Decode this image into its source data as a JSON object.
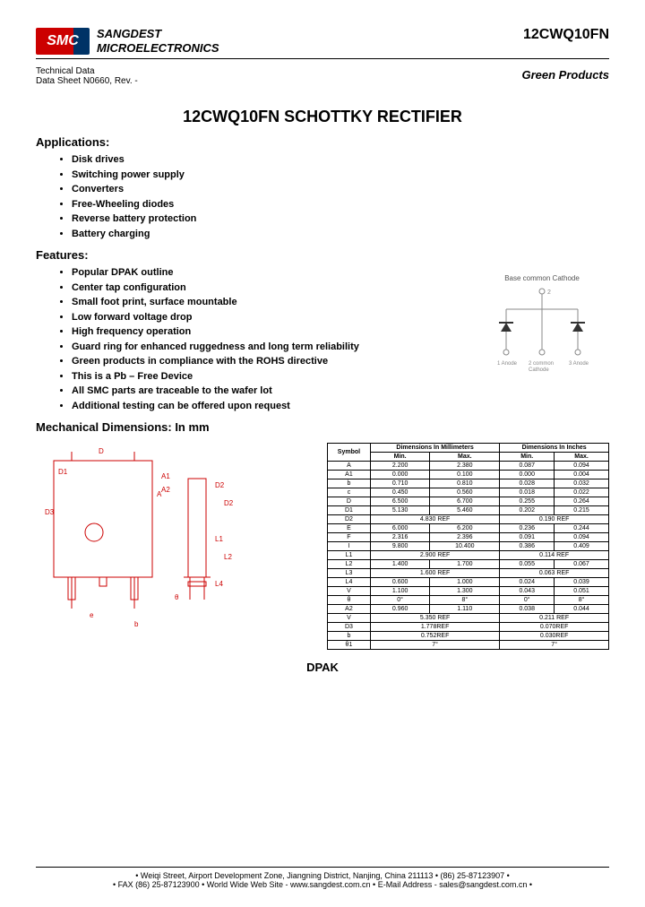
{
  "company_line1": "SANGDEST",
  "company_line2": "MICROELECTRONICS",
  "logo_text": "SMC",
  "part_number": "12CWQ10FN",
  "green_products": "Green Products",
  "tech_line1": "Technical Data",
  "tech_line2": "Data Sheet N0660, Rev. -",
  "title": "12CWQ10FN SCHOTTKY RECTIFIER",
  "applications_h": "Applications:",
  "applications": [
    "Disk drives",
    "Switching power supply",
    "Converters",
    "Free-Wheeling diodes",
    "Reverse battery protection",
    "Battery charging"
  ],
  "features_h": "Features:",
  "features": [
    "Popular DPAK outline",
    "Center tap configuration",
    "Small foot print, surface mountable",
    "Low forward voltage drop",
    "High frequency operation",
    "Guard ring for enhanced ruggedness and long term reliability",
    "Green products in compliance with the ROHS directive",
    "This is a Pb – Free Device",
    "All SMC parts are traceable to the wafer lot",
    "Additional testing can be offered upon request"
  ],
  "circuit_labels": {
    "top": "Base common Cathode",
    "pin1": "1 Anode",
    "pin2": "2 common Cathode",
    "pin3": "3 Anode",
    "topnum": "2"
  },
  "mech_h": "Mechanical Dimensions: In mm",
  "dim_headers": {
    "sym": "Symbol",
    "mm": "Dimensions In Millimeters",
    "in": "Dimensions In Inches",
    "min": "Min.",
    "max": "Max."
  },
  "dims": [
    {
      "s": "A",
      "a": "2.200",
      "b": "2.380",
      "c": "0.087",
      "d": "0.094"
    },
    {
      "s": "A1",
      "a": "0.000",
      "b": "0.100",
      "c": "0.000",
      "d": "0.004"
    },
    {
      "s": "b",
      "a": "0.710",
      "b": "0.810",
      "c": "0.028",
      "d": "0.032"
    },
    {
      "s": "c",
      "a": "0.450",
      "b": "0.560",
      "c": "0.018",
      "d": "0.022"
    },
    {
      "s": "D",
      "a": "6.500",
      "b": "6.700",
      "c": "0.255",
      "d": "0.264"
    },
    {
      "s": "D1",
      "a": "5.130",
      "b": "5.460",
      "c": "0.202",
      "d": "0.215"
    },
    {
      "s": "D2",
      "a": "",
      "b": "4.830 REF",
      "c": "",
      "d": "0.190 REF"
    },
    {
      "s": "E",
      "a": "6.000",
      "b": "6.200",
      "c": "0.236",
      "d": "0.244"
    },
    {
      "s": "F",
      "a": "2.316",
      "b": "2.396",
      "c": "0.091",
      "d": "0.094"
    },
    {
      "s": "I",
      "a": "9.800",
      "b": "10.400",
      "c": "0.386",
      "d": "0.409"
    },
    {
      "s": "L1",
      "a": "",
      "b": "2.900 REF",
      "c": "",
      "d": "0.114 REF"
    },
    {
      "s": "L2",
      "a": "1.400",
      "b": "1.700",
      "c": "0.055",
      "d": "0.067"
    },
    {
      "s": "L3",
      "a": "",
      "b": "1.600 REF",
      "c": "",
      "d": "0.063 REF"
    },
    {
      "s": "L4",
      "a": "0.600",
      "b": "1.000",
      "c": "0.024",
      "d": "0.039"
    },
    {
      "s": "V",
      "a": "1.100",
      "b": "1.300",
      "c": "0.043",
      "d": "0.051"
    },
    {
      "s": "θ",
      "a": "0°",
      "b": "8°",
      "c": "0°",
      "d": "8°"
    },
    {
      "s": "A2",
      "a": "0.960",
      "b": "1.110",
      "c": "0.038",
      "d": "0.044"
    },
    {
      "s": "V",
      "a": "",
      "b": "5.350 REF",
      "c": "",
      "d": "0.211 REF"
    },
    {
      "s": "D3",
      "a": "",
      "b": "1.778REF",
      "c": "",
      "d": "0.070REF"
    },
    {
      "s": "b",
      "a": "",
      "b": "0.752REF",
      "c": "",
      "d": "0.030REF"
    },
    {
      "s": "θ1",
      "a": "",
      "b": "7°",
      "c": "",
      "d": "7°"
    }
  ],
  "dpak": "DPAK",
  "footer_line1": "• Weiqi Street, Airport Development Zone, Jiangning District, Nanjing, China 211113  • (86) 25-87123907 •",
  "footer_line2": "• FAX (86) 25-87123900 • World Wide Web Site - www.sangdest.com.cn • E-Mail Address - sales@sangdest.com.cn •"
}
